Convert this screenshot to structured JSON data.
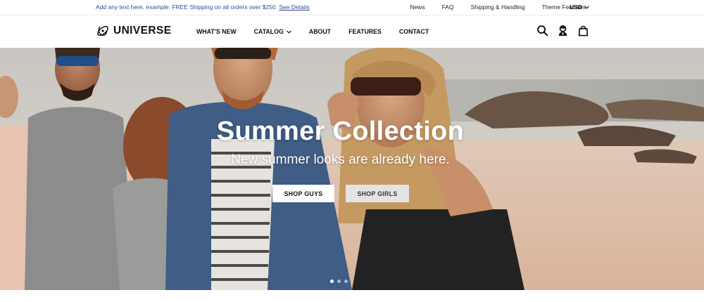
{
  "announcement": {
    "promo_text": "Add any text here, example: FREE Shipping on all orders over $250.",
    "promo_link": "See Details",
    "links": [
      "News",
      "FAQ",
      "Shipping & Handling",
      "Theme Features"
    ],
    "currency": "USD"
  },
  "header": {
    "logo_text": "UNIVERSE",
    "nav": [
      "WHAT'S NEW",
      "CATALOG",
      "ABOUT",
      "FEATURES",
      "CONTACT"
    ],
    "icons": [
      "search-icon",
      "account-icon",
      "cart-icon"
    ]
  },
  "hero": {
    "title": "Summer Collection",
    "subtitle": "New summer looks are already here.",
    "primary_button": "SHOP GUYS",
    "secondary_button": "SHOP GIRLS",
    "slides": {
      "count": 3,
      "active": 1
    }
  },
  "colors": {
    "promo_text": "#2e4c9a",
    "button_primary_bg": "#ffffff",
    "button_secondary_bg": "#e4e4e4"
  }
}
